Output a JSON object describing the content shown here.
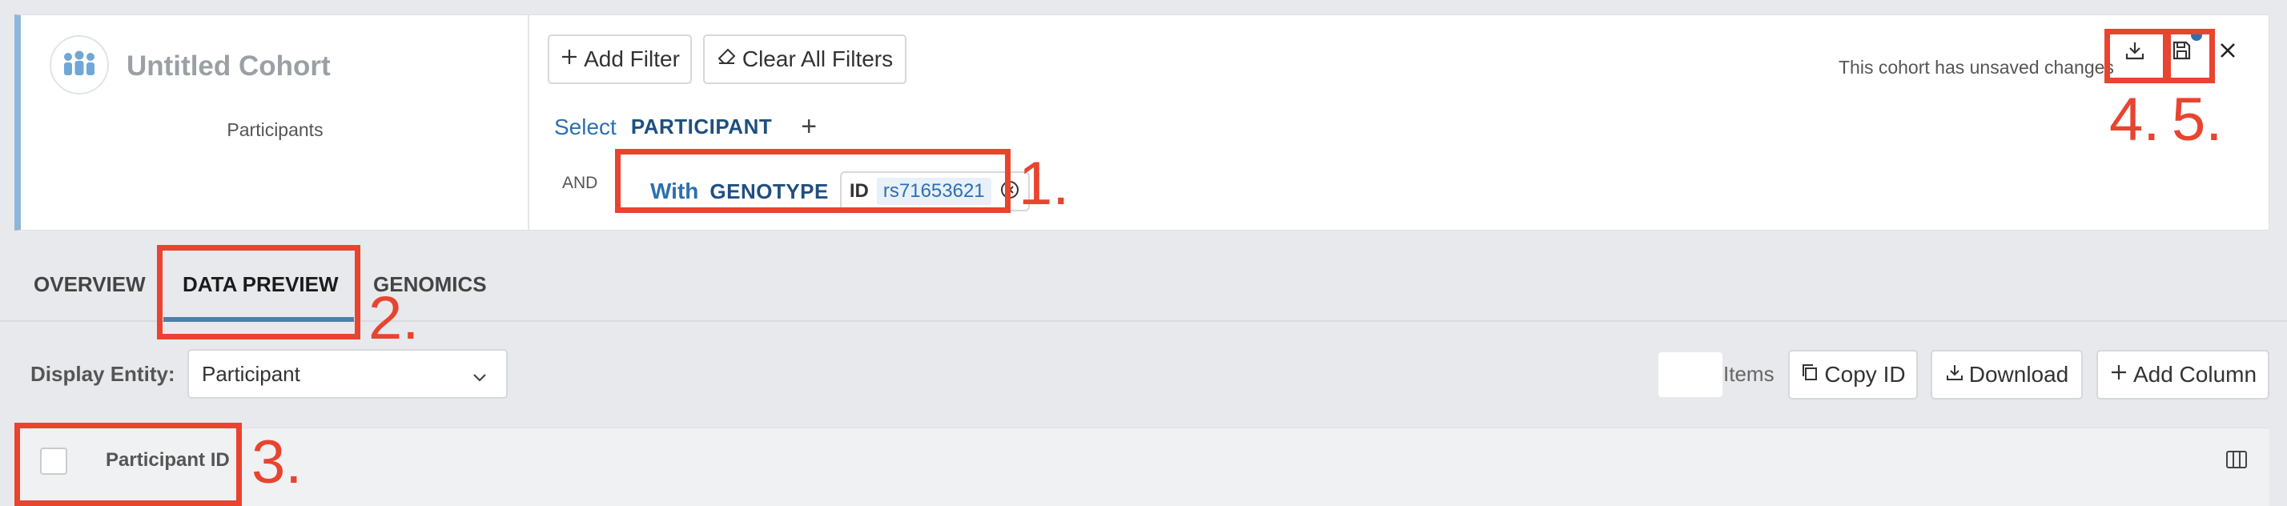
{
  "cohort": {
    "title": "Untitled Cohort",
    "subtitle": "Participants",
    "add_filter_label": "Add Filter",
    "clear_filters_label": "Clear All Filters",
    "select_keyword": "Select",
    "select_entity": "PARTICIPANT",
    "add_symbol": "+",
    "and_label": "AND",
    "filter": {
      "keyword": "With",
      "entity": "GENOTYPE",
      "field": "ID",
      "value": "rs71653621"
    },
    "unsaved_message": "This cohort has unsaved changes"
  },
  "tabs": [
    {
      "label": "OVERVIEW",
      "active": false
    },
    {
      "label": "DATA PREVIEW",
      "active": true
    },
    {
      "label": "GENOMICS",
      "active": false
    }
  ],
  "toolbar": {
    "display_entity_label": "Display Entity:",
    "display_entity_value": "Participant",
    "items_label": "Items",
    "copy_id_label": "Copy ID",
    "download_label": "Download",
    "add_column_label": "Add Column"
  },
  "table": {
    "columns": [
      "Participant ID"
    ]
  },
  "annotations": {
    "n1": "1.",
    "n2": "2.",
    "n3": "3.",
    "n4": "4.",
    "n5": "5."
  },
  "colors": {
    "annotation": "#e8442f",
    "accent": "#2e6fb0",
    "entity": "#1f4f80",
    "card_left_border": "#8fb6d8",
    "tab_underline": "#4f7fa8",
    "unsaved_dot": "#2e6fb0"
  },
  "icons": [
    "cohort-people-icon",
    "plus-icon",
    "eraser-icon",
    "remove-filter-icon",
    "download-icon",
    "save-icon",
    "close-icon",
    "chevron-down-icon",
    "copy-icon",
    "columns-icon"
  ]
}
